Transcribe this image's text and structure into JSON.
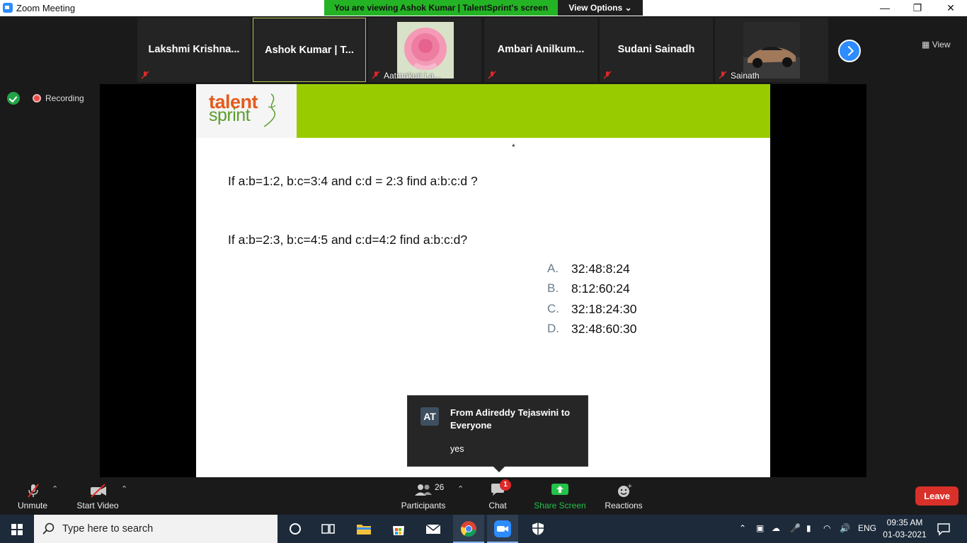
{
  "window": {
    "title": "Zoom Meeting"
  },
  "share_banner": {
    "viewing": "You are viewing Ashok Kumar | TalentSprint's screen",
    "view_options": "View Options"
  },
  "gallery": {
    "tiles": [
      {
        "name": "Lakshmi  Krishna...",
        "sub": ""
      },
      {
        "name": "Ashok Kumar | T...",
        "sub": ""
      },
      {
        "name": "",
        "sub": "Aatmakuri La..."
      },
      {
        "name": "Ambari  Anilkum...",
        "sub": ""
      },
      {
        "name": "Sudani Sainadh",
        "sub": ""
      },
      {
        "name": "",
        "sub": "Sainath"
      }
    ],
    "view_label": "View"
  },
  "status": {
    "recording": "Recording"
  },
  "slide": {
    "logo_line1": "talent",
    "logo_line2": "sprint",
    "dot": "*",
    "question1": "If a:b=1:2, b:c=3:4 and c:d = 2:3 find a:b:c:d ?",
    "question2": "If a:b=2:3, b:c=4:5 and c:d=4:2 find a:b:c:d?",
    "options": [
      {
        "letter": "A.",
        "text": "32:48:8:24"
      },
      {
        "letter": "B.",
        "text": "8:12:60:24"
      },
      {
        "letter": "C.",
        "text": "32:18:24:30"
      },
      {
        "letter": "D.",
        "text": "32:48:60:30"
      }
    ]
  },
  "chat_toast": {
    "initials": "AT",
    "from": "From Adireddy Tejaswini to Everyone",
    "message": "yes"
  },
  "toolbar": {
    "unmute": "Unmute",
    "start_video": "Start Video",
    "participants": "Participants",
    "participants_count": "26",
    "chat": "Chat",
    "chat_badge": "1",
    "share_screen": "Share Screen",
    "reactions": "Reactions",
    "leave": "Leave"
  },
  "taskbar": {
    "search_placeholder": "Type here to search",
    "lang": "ENG",
    "time": "09:35 AM",
    "date": "01-03-2021"
  },
  "colors": {
    "zoom_blue": "#2d8cff",
    "share_green": "#24b324",
    "leave_red": "#d9302a",
    "slide_green": "#99cc00"
  }
}
